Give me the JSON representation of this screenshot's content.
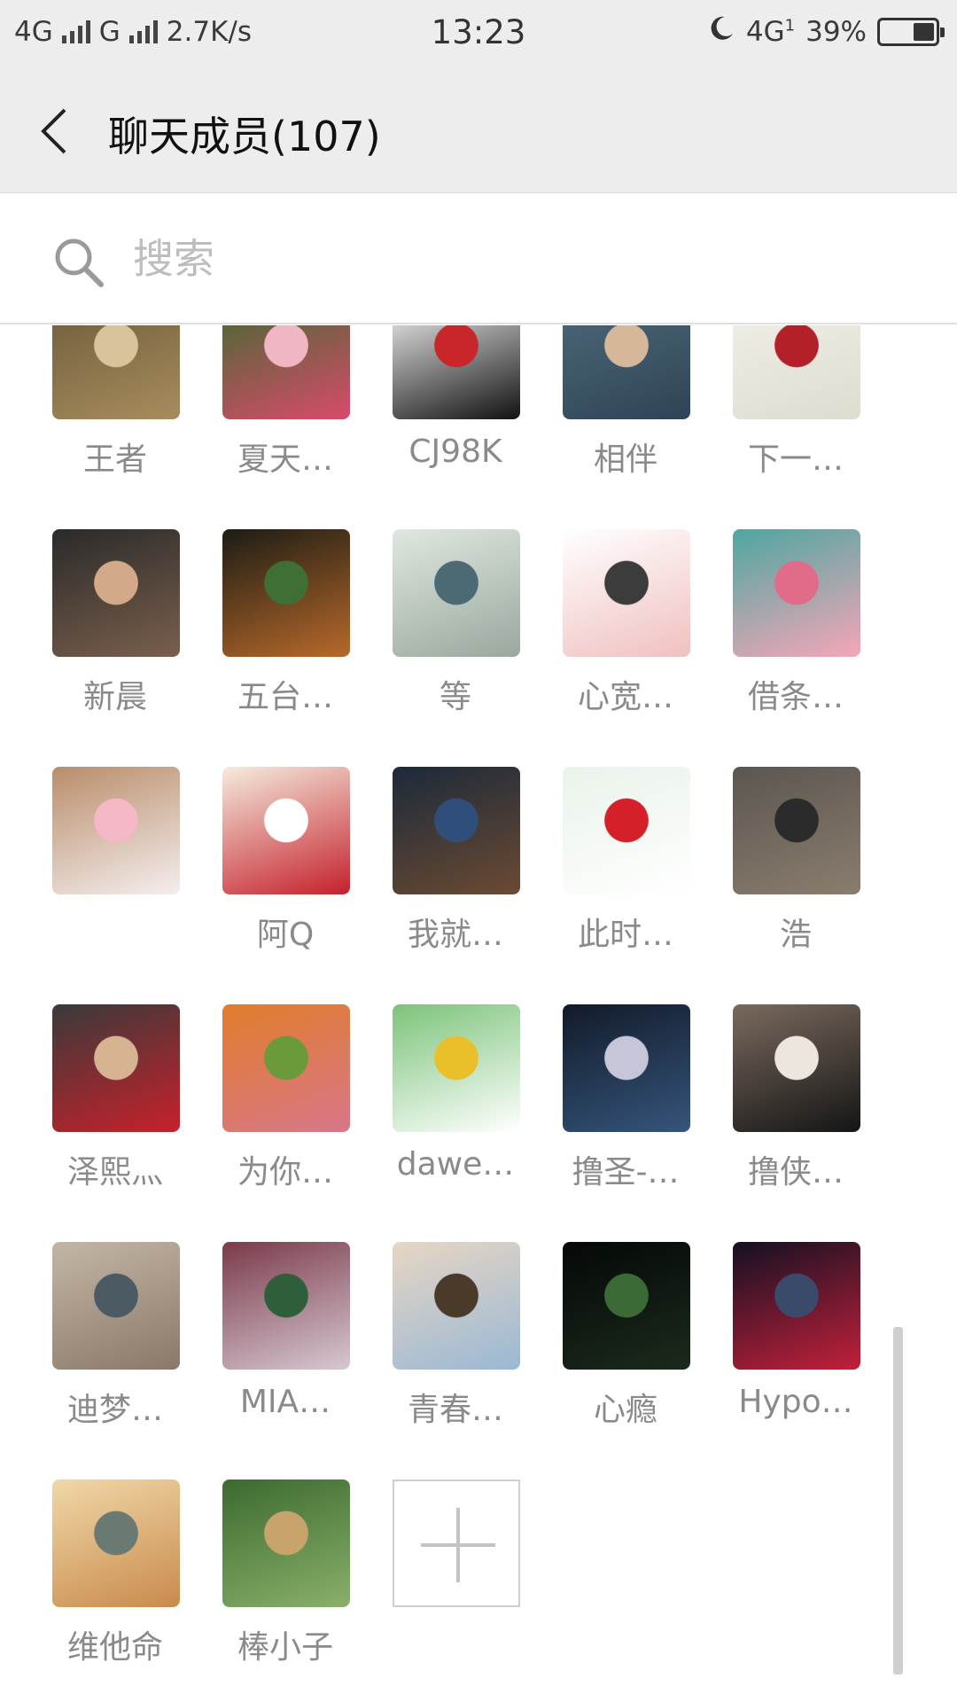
{
  "status_bar": {
    "network_1": "4G",
    "network_2": "G",
    "speed": "2.7K/s",
    "time": "13:23",
    "moon_icon": "moon-icon",
    "network_3": "4G",
    "sim_index": "1",
    "battery": "39%",
    "battery_level": 0.39
  },
  "header": {
    "back_icon": "chevron-left-icon",
    "title": "聊天成员(107)"
  },
  "search": {
    "icon": "search-icon",
    "placeholder": "搜索"
  },
  "members": [
    {
      "name": "王者",
      "avatar_colors": [
        "#6b5a3a",
        "#a88c5c",
        "#d8c39a"
      ]
    },
    {
      "name": "夏天…",
      "avatar_colors": [
        "#3d6b2f",
        "#d94a6a",
        "#f0b6c4"
      ]
    },
    {
      "name": "CJ98K",
      "avatar_colors": [
        "#ffffff",
        "#111111",
        "#c8262b"
      ]
    },
    {
      "name": "相伴",
      "avatar_colors": [
        "#4e6a7c",
        "#2e4456",
        "#d7b79a"
      ]
    },
    {
      "name": "下一…",
      "avatar_colors": [
        "#f1f1ea",
        "#dcdccf",
        "#b3202a"
      ]
    },
    {
      "name": "新晨",
      "avatar_colors": [
        "#2a2a2a",
        "#7a5f4c",
        "#d4a98a"
      ]
    },
    {
      "name": "五台…",
      "avatar_colors": [
        "#1c1c14",
        "#b8692a",
        "#3f6f35"
      ]
    },
    {
      "name": "等",
      "avatar_colors": [
        "#dfe8e0",
        "#9aa79e",
        "#4b6a74"
      ]
    },
    {
      "name": "心宽…",
      "avatar_colors": [
        "#ffffff",
        "#f0c0c0",
        "#3c3c3c"
      ]
    },
    {
      "name": "借条…",
      "avatar_colors": [
        "#4ea6a0",
        "#f5a6b8",
        "#e06c8a"
      ]
    },
    {
      "name": "",
      "avatar_colors": [
        "#b98d6a",
        "#f4eeee",
        "#f5b8c6"
      ]
    },
    {
      "name": "阿Q",
      "avatar_colors": [
        "#f5ecdd",
        "#c5202c",
        "#ffffff"
      ]
    },
    {
      "name": "我就…",
      "avatar_colors": [
        "#1c2a3a",
        "#6b4a32",
        "#2f4f7a"
      ]
    },
    {
      "name": "此时…",
      "avatar_colors": [
        "#e9f3ea",
        "#ffffff",
        "#d5202a"
      ]
    },
    {
      "name": "浩",
      "avatar_colors": [
        "#5b5650",
        "#8a7d6e",
        "#2b2b2b"
      ]
    },
    {
      "name": "泽熙灬",
      "avatar_colors": [
        "#3a3a3a",
        "#c8202a",
        "#d7b491"
      ]
    },
    {
      "name": "为你…",
      "avatar_colors": [
        "#e07d2b",
        "#d9768a",
        "#6b9a3a"
      ]
    },
    {
      "name": "dawe…",
      "avatar_colors": [
        "#7cc37a",
        "#ffffff",
        "#e9c02a"
      ]
    },
    {
      "name": "撸圣-…",
      "avatar_colors": [
        "#121a2a",
        "#35557a",
        "#c6c6d8"
      ]
    },
    {
      "name": "撸侠…",
      "avatar_colors": [
        "#7a6a5e",
        "#151515",
        "#ece6de"
      ]
    },
    {
      "name": "迪梦…",
      "avatar_colors": [
        "#c4b6a6",
        "#8a7868",
        "#4c5a64"
      ]
    },
    {
      "name": "MIA…",
      "avatar_colors": [
        "#7b3a4a",
        "#d6c8d2",
        "#2f5f3a"
      ]
    },
    {
      "name": "青春…",
      "avatar_colors": [
        "#e7d6c4",
        "#9ab8d4",
        "#4a3a2a"
      ]
    },
    {
      "name": "心瘾",
      "avatar_colors": [
        "#050807",
        "#1b2a1c",
        "#3c6a36"
      ]
    },
    {
      "name": "Hypo…",
      "avatar_colors": [
        "#141022",
        "#c2203a",
        "#3a4a6a"
      ]
    },
    {
      "name": "维他命",
      "avatar_colors": [
        "#f0d8a8",
        "#c98a4c",
        "#6a7a72"
      ]
    },
    {
      "name": "棒小子",
      "avatar_colors": [
        "#3b6a2f",
        "#8ab06a",
        "#c8a46a"
      ]
    }
  ],
  "add_member": {
    "icon": "plus-icon"
  }
}
